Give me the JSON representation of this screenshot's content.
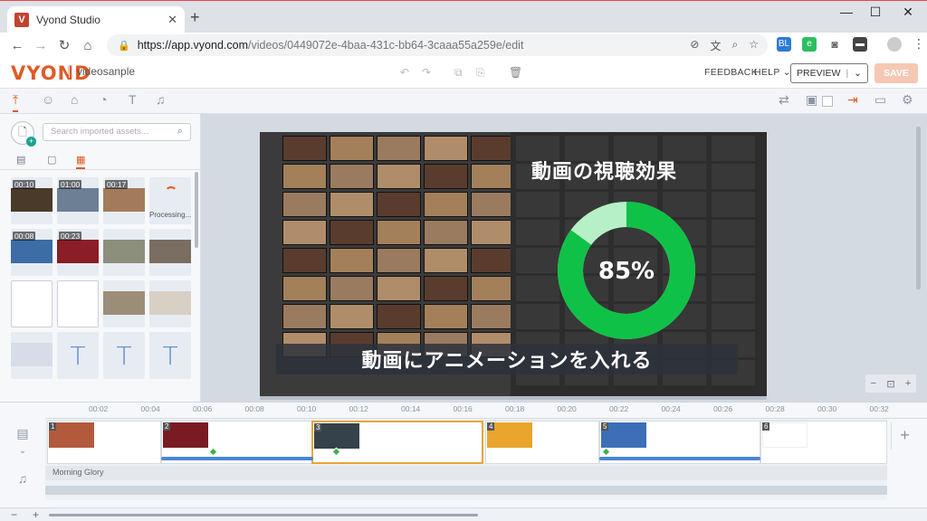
{
  "browser": {
    "tab_title": "Vyond Studio",
    "tab_favicon": "V",
    "url_prefix": "https://app.vyond.com",
    "url_rest": "/videos/0449072e-4baa-431c-bb64-3caaa55a259e/edit"
  },
  "app": {
    "logo": "VYOND",
    "project_name": "videosanple",
    "feedback": "FEEDBACK",
    "help": "HELP",
    "preview": "PREVIEW",
    "save": "SAVE",
    "brand_color": "#e05a26"
  },
  "library": {
    "search_placeholder": "Search imported assets...",
    "processing_label": "Processing...",
    "items": [
      {
        "type": "video",
        "duration": "00:10",
        "color": "#4a3a2a"
      },
      {
        "type": "video",
        "duration": "01:00",
        "color": "#6d7f95"
      },
      {
        "type": "video",
        "duration": "00:17",
        "color": "#a37b5c"
      },
      {
        "type": "processing"
      },
      {
        "type": "video",
        "duration": "00:08",
        "color": "#3c6da4"
      },
      {
        "type": "video",
        "duration": "00:23",
        "color": "#8a1d25"
      },
      {
        "type": "image",
        "color": "#8c8f7c"
      },
      {
        "type": "image",
        "color": "#7a6e63"
      },
      {
        "type": "image",
        "color": "#ffffff"
      },
      {
        "type": "image",
        "color": "#ffffff"
      },
      {
        "type": "image",
        "color": "#9b8d78"
      },
      {
        "type": "image",
        "color": "#d8cfc5"
      },
      {
        "type": "image",
        "color": "#d6dde8"
      },
      {
        "type": "text"
      },
      {
        "type": "text"
      },
      {
        "type": "text"
      }
    ]
  },
  "stage": {
    "headline": "動画の視聴効果",
    "donut_percent": 85,
    "donut_label": "85%",
    "subtitle": "動画にアニメーションを入れる",
    "donut_color": "#10c148",
    "donut_rest_color": "#b6f0c6"
  },
  "timeline": {
    "ticks": [
      "00:02",
      "00:04",
      "00:06",
      "00:08",
      "00:10",
      "00:12",
      "00:14",
      "00:16",
      "00:18",
      "00:20",
      "00:22",
      "00:24",
      "00:26",
      "00:28",
      "00:30",
      "00:32"
    ],
    "scenes": [
      {
        "num": "1",
        "color": "#b35a3d"
      },
      {
        "num": "2",
        "color": "#7a1b22"
      },
      {
        "num": "3",
        "color": "#35414b"
      },
      {
        "num": "4",
        "color": "#e9a52c"
      },
      {
        "num": "5",
        "color": "#3c6fb8"
      },
      {
        "num": "6",
        "color": "#ffffff"
      }
    ],
    "audio_track": "Morning Glory"
  }
}
